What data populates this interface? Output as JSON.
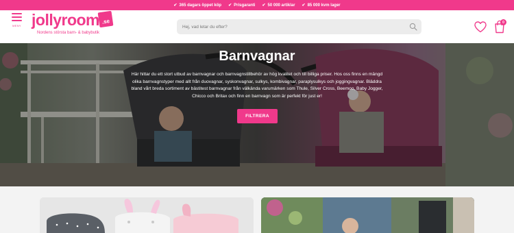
{
  "topbar": {
    "usps": [
      "365 dagars öppet köp",
      "Prisgaranti",
      "50 000 artiklar",
      "85 000 kvm lager"
    ]
  },
  "header": {
    "menu_label": "MENY",
    "logo_text": "jollyroom",
    "logo_tld": ".se",
    "tagline": "Nordens största barn- & babybutik",
    "search_placeholder": "Hej, vad letar du efter?",
    "cart_count": "0"
  },
  "hero": {
    "title": "Barnvagnar",
    "description": "Här hittar du ett stort utbud av barnvagnar och barnvagnstillbehör av hög kvalitet och till billiga priser. Hos oss finns en mängd olika barnvagnstyper med allt från duovagnar, syskonvagnar, sulkys, kombivagnar, paraplysulkys och joggingvagnar. Bläddra bland vårt breda sortiment av bästitest barnvagnar från välkända varumärken som Thule, Silver Cross, Beemoo, Baby Jogger, Chicco och Britax och finn en barnvagn som är perfekt för just er!",
    "filter_button": "FILTRERA"
  },
  "colors": {
    "brand_pink": "#f0398b",
    "search_bg": "#ececec"
  },
  "icons": [
    "hamburger-menu-icon",
    "search-icon",
    "heart-icon",
    "shopping-bag-icon",
    "check-icon"
  ]
}
